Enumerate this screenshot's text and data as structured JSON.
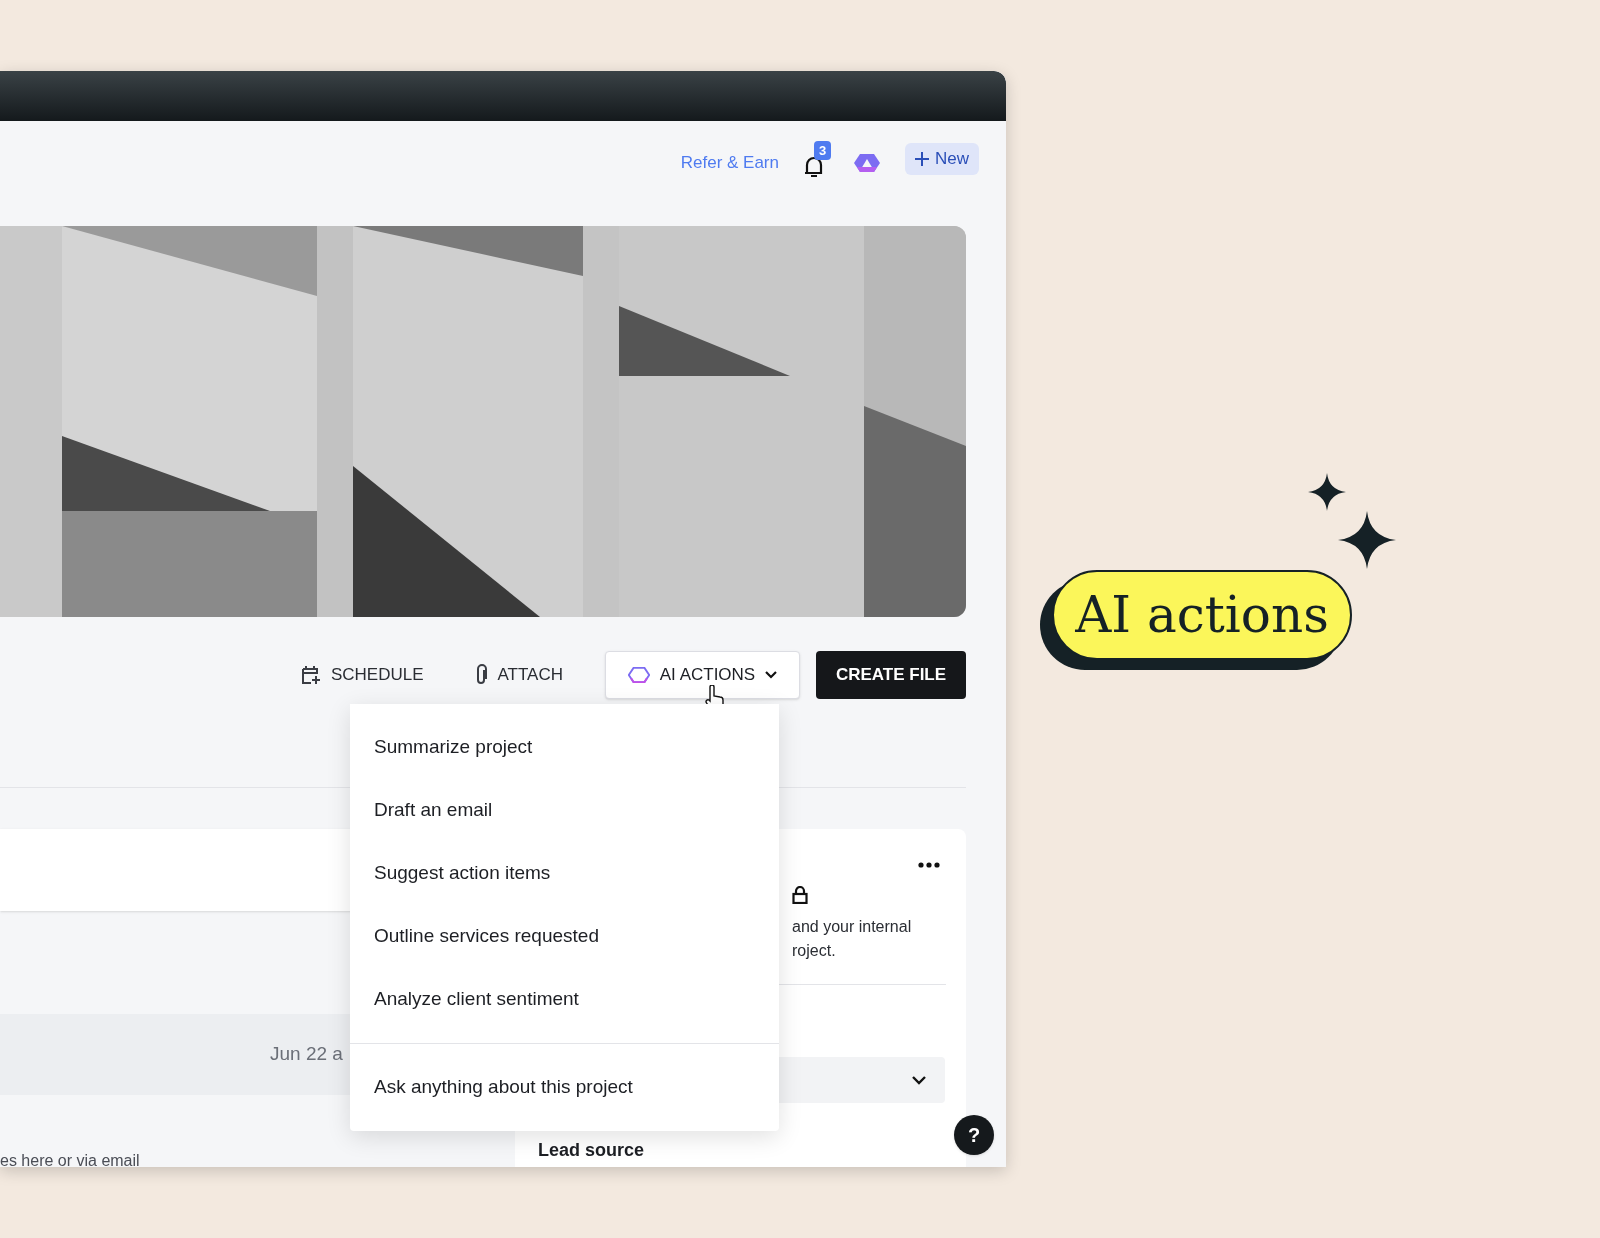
{
  "header": {
    "refer_link": "Refer & Earn",
    "notification_count": "3",
    "new_button": "New"
  },
  "actions": [
    {
      "label": "SCHEDULE",
      "kind": "schedule"
    },
    {
      "label": "ATTACH",
      "kind": "attach"
    },
    {
      "label": "AI ACTIONS",
      "kind": "ai_dropdown",
      "expanded": true
    },
    {
      "label": "CREATE FILE",
      "kind": "primary"
    }
  ],
  "ai_menu": {
    "items": [
      "Summarize project",
      "Draft an email",
      "Suggest action items",
      "Outline services requested",
      "Analyze client sentiment"
    ],
    "footer_item": "Ask anything about this project"
  },
  "activity": {
    "date": "Jun 22 a",
    "hint": "es here or via email"
  },
  "side_card": {
    "text_lines": [
      "and your internal",
      "roject."
    ],
    "section_label": "Lead source"
  },
  "help_button": "?",
  "callout": "AI actions"
}
